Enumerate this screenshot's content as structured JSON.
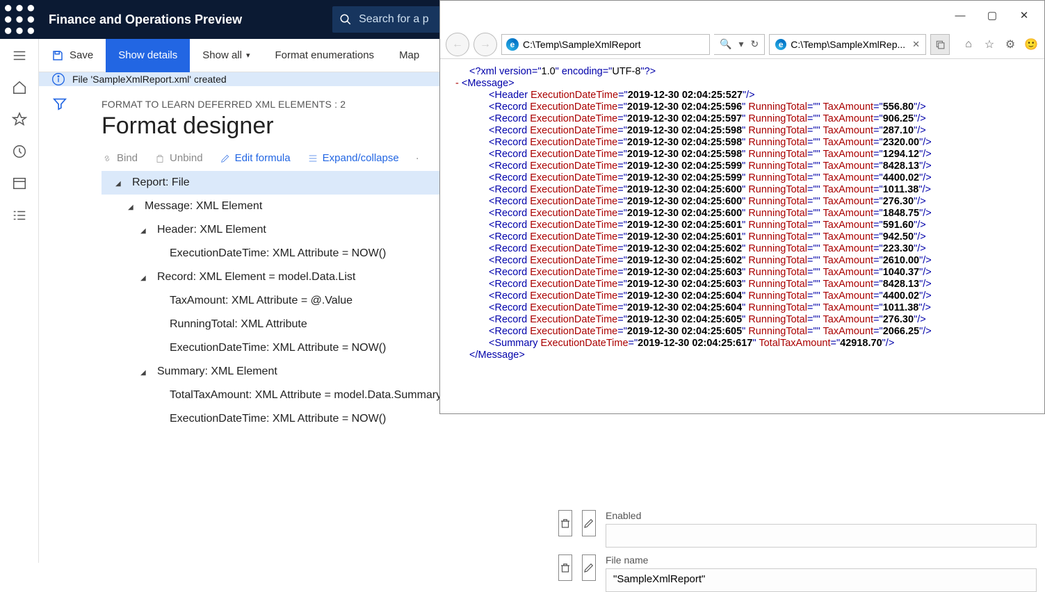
{
  "topbar": {
    "app_title": "Finance and Operations Preview",
    "search_placeholder": "Search for a p"
  },
  "cmdbar": {
    "save": "Save",
    "show_details": "Show details",
    "show_all": "Show all",
    "format_enum": "Format enumerations",
    "map": "Map"
  },
  "infobar": {
    "msg": "File 'SampleXmlReport.xml' created"
  },
  "designer": {
    "crumb": "FORMAT TO LEARN DEFERRED XML ELEMENTS : 2",
    "title": "Format designer",
    "toolbar": {
      "bind": "Bind",
      "unbind": "Unbind",
      "edit": "Edit formula",
      "expand": "Expand/collapse"
    },
    "tree": [
      {
        "lvl": 0,
        "caret": true,
        "sel": true,
        "txt": "Report: File"
      },
      {
        "lvl": 1,
        "caret": true,
        "txt": "Message: XML Element"
      },
      {
        "lvl": 2,
        "caret": true,
        "txt": "Header: XML Element"
      },
      {
        "lvl": 3,
        "txt": "ExecutionDateTime: XML Attribute = NOW()"
      },
      {
        "lvl": 2,
        "caret": true,
        "txt": "Record: XML Element = model.Data.List"
      },
      {
        "lvl": 3,
        "txt": "TaxAmount: XML Attribute = @.Value"
      },
      {
        "lvl": 3,
        "txt": "RunningTotal: XML Attribute"
      },
      {
        "lvl": 3,
        "txt": "ExecutionDateTime: XML Attribute = NOW()"
      },
      {
        "lvl": 2,
        "caret": true,
        "txt": "Summary: XML Element"
      },
      {
        "lvl": 3,
        "txt": "TotalTaxAmount: XML Attribute = model.Data.Summary.Total"
      },
      {
        "lvl": 3,
        "txt": "ExecutionDateTime: XML Attribute = NOW()"
      }
    ]
  },
  "fields": {
    "enabled_lbl": "Enabled",
    "enabled_val": "",
    "filename_lbl": "File name",
    "filename_val": "\"SampleXmlReport\""
  },
  "ie": {
    "address": "C:\\Temp\\SampleXmlReport",
    "tab_title": "C:\\Temp\\SampleXmlRep...",
    "xml": {
      "decl": "<?xml version=\"1.0\" encoding=\"UTF-8\"?>",
      "root_open": "Message",
      "header": {
        "tag": "Header",
        "ExecutionDateTime": "2019-12-30 02:04:25:527"
      },
      "records": [
        {
          "ExecutionDateTime": "2019-12-30 02:04:25:596",
          "RunningTotal": "",
          "TaxAmount": "556.80"
        },
        {
          "ExecutionDateTime": "2019-12-30 02:04:25:597",
          "RunningTotal": "",
          "TaxAmount": "906.25"
        },
        {
          "ExecutionDateTime": "2019-12-30 02:04:25:598",
          "RunningTotal": "",
          "TaxAmount": "287.10"
        },
        {
          "ExecutionDateTime": "2019-12-30 02:04:25:598",
          "RunningTotal": "",
          "TaxAmount": "2320.00"
        },
        {
          "ExecutionDateTime": "2019-12-30 02:04:25:598",
          "RunningTotal": "",
          "TaxAmount": "1294.12"
        },
        {
          "ExecutionDateTime": "2019-12-30 02:04:25:599",
          "RunningTotal": "",
          "TaxAmount": "8428.13"
        },
        {
          "ExecutionDateTime": "2019-12-30 02:04:25:599",
          "RunningTotal": "",
          "TaxAmount": "4400.02"
        },
        {
          "ExecutionDateTime": "2019-12-30 02:04:25:600",
          "RunningTotal": "",
          "TaxAmount": "1011.38"
        },
        {
          "ExecutionDateTime": "2019-12-30 02:04:25:600",
          "RunningTotal": "",
          "TaxAmount": "276.30"
        },
        {
          "ExecutionDateTime": "2019-12-30 02:04:25:600",
          "RunningTotal": "",
          "TaxAmount": "1848.75"
        },
        {
          "ExecutionDateTime": "2019-12-30 02:04:25:601",
          "RunningTotal": "",
          "TaxAmount": "591.60"
        },
        {
          "ExecutionDateTime": "2019-12-30 02:04:25:601",
          "RunningTotal": "",
          "TaxAmount": "942.50"
        },
        {
          "ExecutionDateTime": "2019-12-30 02:04:25:602",
          "RunningTotal": "",
          "TaxAmount": "223.30"
        },
        {
          "ExecutionDateTime": "2019-12-30 02:04:25:602",
          "RunningTotal": "",
          "TaxAmount": "2610.00"
        },
        {
          "ExecutionDateTime": "2019-12-30 02:04:25:603",
          "RunningTotal": "",
          "TaxAmount": "1040.37"
        },
        {
          "ExecutionDateTime": "2019-12-30 02:04:25:603",
          "RunningTotal": "",
          "TaxAmount": "8428.13"
        },
        {
          "ExecutionDateTime": "2019-12-30 02:04:25:604",
          "RunningTotal": "",
          "TaxAmount": "4400.02"
        },
        {
          "ExecutionDateTime": "2019-12-30 02:04:25:604",
          "RunningTotal": "",
          "TaxAmount": "1011.38"
        },
        {
          "ExecutionDateTime": "2019-12-30 02:04:25:605",
          "RunningTotal": "",
          "TaxAmount": "276.30"
        },
        {
          "ExecutionDateTime": "2019-12-30 02:04:25:605",
          "RunningTotal": "",
          "TaxAmount": "2066.25"
        }
      ],
      "summary": {
        "ExecutionDateTime": "2019-12-30 02:04:25:617",
        "TotalTaxAmount": "42918.70"
      },
      "root_close": "Message"
    }
  }
}
